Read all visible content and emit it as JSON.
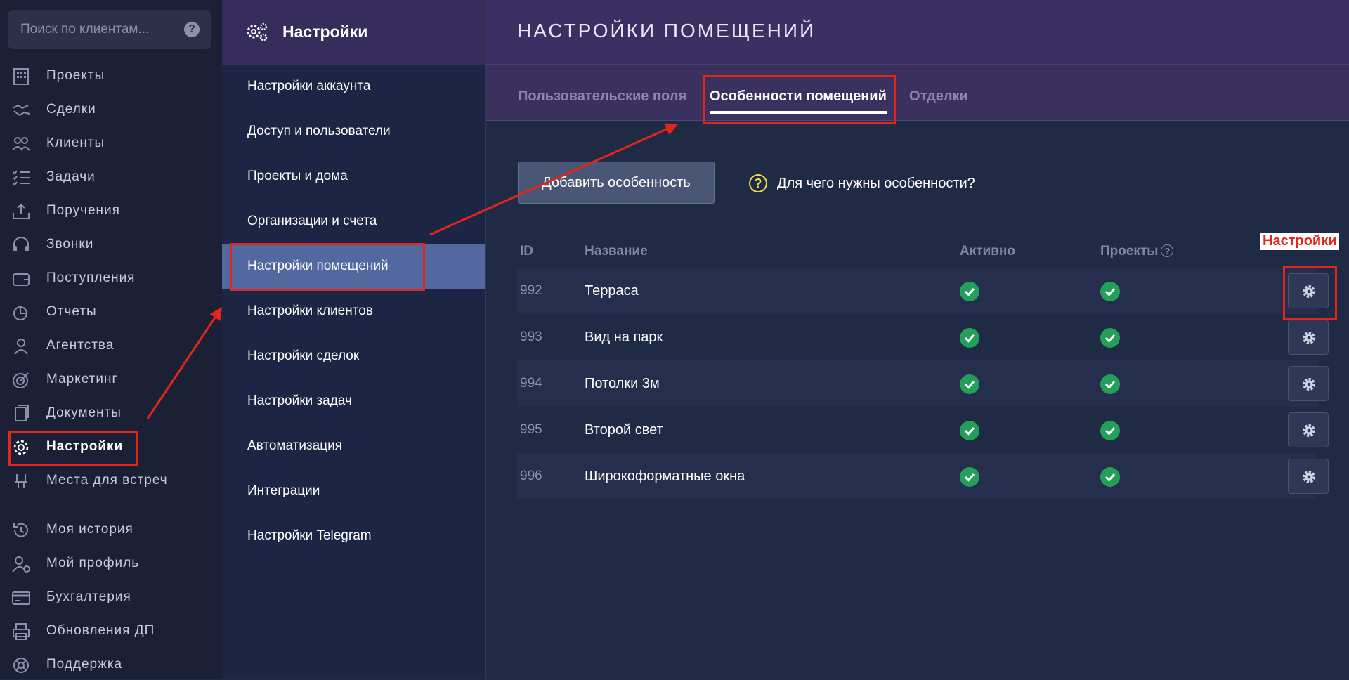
{
  "search": {
    "placeholder": "Поиск по клиентам..."
  },
  "nav": {
    "items": [
      {
        "label": "Проекты",
        "icon": "building-icon"
      },
      {
        "label": "Сделки",
        "icon": "handshake-icon"
      },
      {
        "label": "Клиенты",
        "icon": "users-icon"
      },
      {
        "label": "Задачи",
        "icon": "checklist-icon"
      },
      {
        "label": "Поручения",
        "icon": "tray-upload-icon"
      },
      {
        "label": "Звонки",
        "icon": "headset-icon"
      },
      {
        "label": "Поступления",
        "icon": "wallet-icon"
      },
      {
        "label": "Отчеты",
        "icon": "pie-chart-icon"
      },
      {
        "label": "Агентства",
        "icon": "agent-icon"
      },
      {
        "label": "Маркетинг",
        "icon": "target-icon"
      },
      {
        "label": "Документы",
        "icon": "documents-icon"
      },
      {
        "label": "Настройки",
        "icon": "gear-icon",
        "active": true
      },
      {
        "label": "Места для встреч",
        "icon": "location-chair-icon"
      },
      {
        "label": "Моя история",
        "icon": "history-icon"
      },
      {
        "label": "Мой профиль",
        "icon": "user-gear-icon"
      },
      {
        "label": "Бухгалтерия",
        "icon": "credit-card-icon"
      },
      {
        "label": "Обновления ДП",
        "icon": "printer-icon"
      },
      {
        "label": "Поддержка",
        "icon": "lifebuoy-icon"
      }
    ]
  },
  "settings": {
    "title": "Настройки",
    "items": [
      {
        "label": "Настройки аккаунта"
      },
      {
        "label": "Доступ и пользователи"
      },
      {
        "label": "Проекты и дома"
      },
      {
        "label": "Организации и счета"
      },
      {
        "label": "Настройки помещений",
        "active": true
      },
      {
        "label": "Настройки клиентов"
      },
      {
        "label": "Настройки сделок"
      },
      {
        "label": "Настройки задач"
      },
      {
        "label": "Автоматизация"
      },
      {
        "label": "Интеграции"
      },
      {
        "label": "Настройки Telegram"
      }
    ]
  },
  "main": {
    "title": "НАСТРОЙКИ ПОМЕЩЕНИЙ",
    "tabs": [
      {
        "label": "Пользовательские поля"
      },
      {
        "label": "Особенности помещений",
        "active": true
      },
      {
        "label": "Отделки"
      }
    ],
    "add_button": "Добавить особенность",
    "help_link": "Для чего нужны особенности?",
    "help_icon": "?",
    "table": {
      "headers": {
        "id": "ID",
        "name": "Название",
        "active": "Активно",
        "projects": "Проекты"
      },
      "rows": [
        {
          "id": "992",
          "name": "Терраса",
          "active": true,
          "projects": true
        },
        {
          "id": "993",
          "name": "Вид на парк",
          "active": true,
          "projects": true
        },
        {
          "id": "994",
          "name": "Потолки 3м",
          "active": true,
          "projects": true
        },
        {
          "id": "995",
          "name": "Второй свет",
          "active": true,
          "projects": true
        },
        {
          "id": "996",
          "name": "Широкоформатные окна",
          "active": true,
          "projects": true
        }
      ]
    }
  },
  "annotation": {
    "label": "Настройки",
    "color": "#e3261c"
  },
  "colors": {
    "check": "#22a05a",
    "accent_active": "#52689f",
    "header_purple": "#3c2f63"
  }
}
